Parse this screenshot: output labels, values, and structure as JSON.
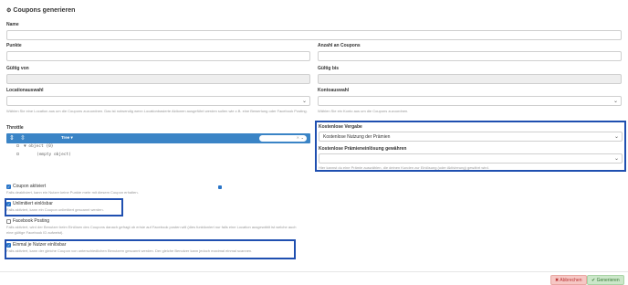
{
  "page": {
    "title": "Coupons generieren"
  },
  "fields": {
    "name": "Name",
    "punkte": "Punkte",
    "anzahl": "Anzahl an Coupons",
    "gueltig_von": "Gültig von",
    "gueltig_bis": "Gültig bis",
    "locationauswahl": "Locationauswahl",
    "location_help": "Wählen Sie eine Location aus um die Coupons zuzuordnen. Das ist notwendig wenn Locationbasierte Aktionen ausgeführt werden sollen wie z.B. eine Bewertung oder Facebook Posting.",
    "kontoauswahl": "Kontoauswahl",
    "konto_help": "Wählen Sie ein Konto aus um die Coupons zuzuordnen.",
    "throttle": "Throttle",
    "kostenlose_vergabe": "Kostenlose Vergabe",
    "kostenlose_vergabe_value": "Kostenlose Nutzung der Prämien",
    "kostenlose_praemie": "Kostenlose Prämieneinlösung gewähren",
    "kostenlose_help": "Hier kannst du eine Prämie auswählen, die deinen Kunden zur Einlösung (oder Aktivierung) gewährt wird."
  },
  "json_editor": {
    "mode": "Tree ▾",
    "node_object": "▼ object {0}",
    "node_empty": "(empty object)"
  },
  "checkboxes": {
    "coupon_aktiviert": "Coupon aktiviert",
    "coupon_aktiviert_help": "Falls deaktiviert, kann ein Nutzer keine Punkte mehr mit diesem Coupon erhalten.",
    "unlimitiert": "Unlimitiert einlösbar",
    "unlimitiert_help": "Falls aktiviert, kann ein Coupon unlimitiert gescannt werden.",
    "facebook": "Facebook Posting",
    "facebook_help": "Falls aktiviert, wird der Benutzer beim Einlösen des Coupons danach gefragt ob er/sie auf Facebook posten will (dies funktioniert nur falls eine Location ausgewählt ist welche auch eine gültige Facebook ID aufweist).",
    "einmal": "Einmal je Nutzer einlösbar",
    "einmal_help": "Falls aktiviert, kann der gleiche Coupon von unterschiedlichen Benutzern gescannt werden. Der gleiche Benutzer kann jedoch maximal einmal scannen."
  },
  "buttons": {
    "abbrechen": "✖ Abbrechen",
    "generieren": "✔ Generieren"
  },
  "colors": {
    "accent": "#3a84c6",
    "highlight": "#1f4fb0"
  }
}
